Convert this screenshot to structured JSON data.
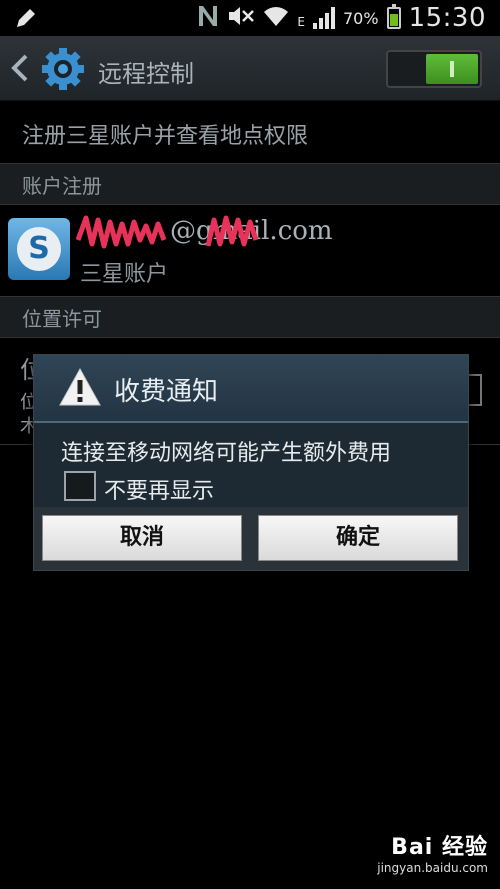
{
  "status_bar": {
    "battery_percent": "70%",
    "battery_level": 0.7,
    "time": "15:30",
    "network_type": "E",
    "notification_icon": "pencil-icon",
    "icons": [
      "nfc-icon",
      "mute-icon",
      "wifi-icon",
      "signal-icon",
      "battery-icon"
    ]
  },
  "action_bar": {
    "title": "远程控制",
    "toggle_on": true,
    "accent": "#4fae2c"
  },
  "list": {
    "register_permission": "注册三星账户并查看地点权限",
    "section_account": "账户注册",
    "account_email": "@gmail.com",
    "account_type": "三星账户",
    "section_location": "位置许可",
    "partial_row_initial": "位",
    "partial_row_sub_a": "位",
    "partial_row_sub_b": "木"
  },
  "dialog": {
    "title": "收费通知",
    "message": "连接至移动网络可能产生额外费用",
    "checkbox_label": "不要再显示",
    "checkbox_checked": false,
    "cancel_label": "取消",
    "ok_label": "确定"
  },
  "watermark": {
    "main": "Bai 经验",
    "sub": "jingyan.baidu.com"
  }
}
